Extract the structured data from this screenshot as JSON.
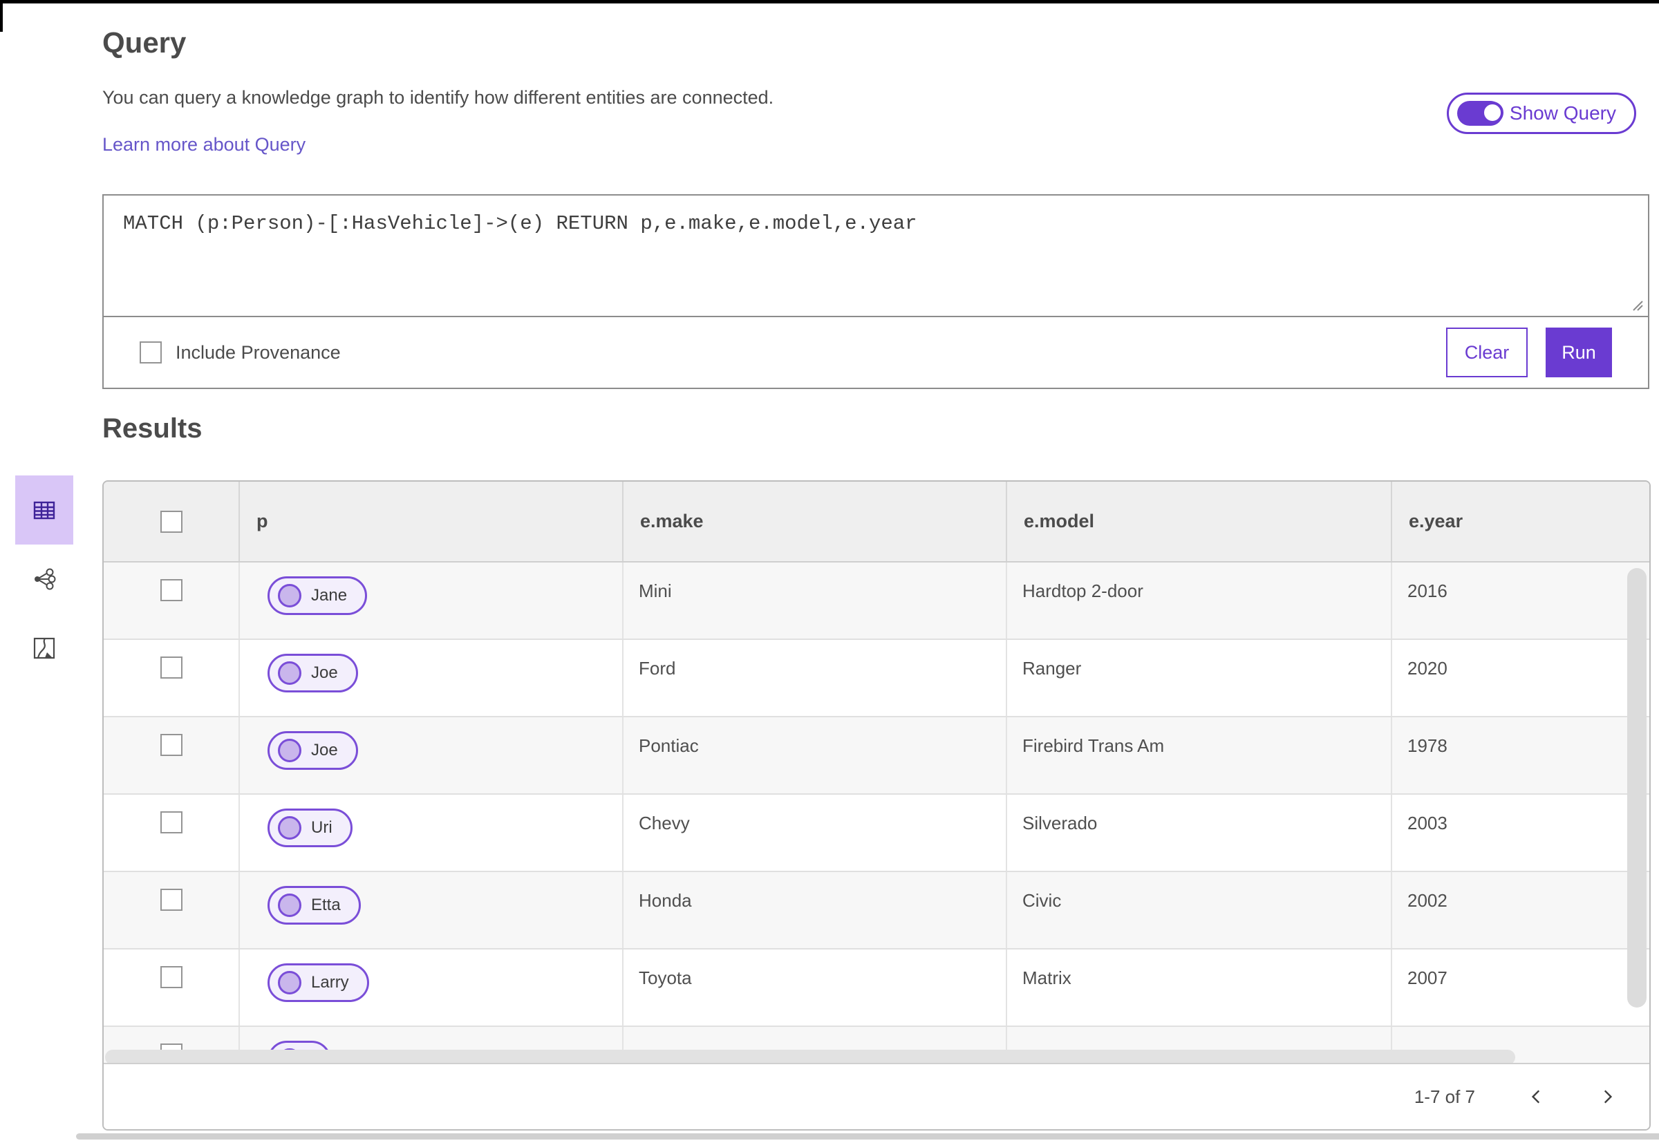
{
  "page": {
    "title": "Query",
    "description": "You can query a knowledge graph to identify how different entities are connected.",
    "learn_more_label": "Learn more about Query",
    "show_query_label": "Show Query",
    "show_query_on": true
  },
  "query_panel": {
    "statement": "MATCH (p:Person)-[:HasVehicle]->(e) RETURN p,e.make,e.model,e.year",
    "include_provenance_label": "Include Provenance",
    "include_provenance_checked": false,
    "clear_label": "Clear",
    "run_label": "Run"
  },
  "results": {
    "title": "Results",
    "view_tabs": [
      {
        "name": "table-view",
        "selected": true
      },
      {
        "name": "link-chart-view",
        "selected": false
      },
      {
        "name": "map-view",
        "selected": false
      }
    ],
    "table": {
      "columns": [
        "p",
        "e.make",
        "e.model",
        "e.year"
      ],
      "rows": [
        {
          "p": "Jane",
          "make": "Mini",
          "model": "Hardtop 2-door",
          "year": "2016"
        },
        {
          "p": "Joe",
          "make": "Ford",
          "model": "Ranger",
          "year": "2020"
        },
        {
          "p": "Joe",
          "make": "Pontiac",
          "model": "Firebird Trans Am",
          "year": "1978"
        },
        {
          "p": "Uri",
          "make": "Chevy",
          "model": "Silverado",
          "year": "2003"
        },
        {
          "p": "Etta",
          "make": "Honda",
          "model": "Civic",
          "year": "2002"
        },
        {
          "p": "Larry",
          "make": "Toyota",
          "model": "Matrix",
          "year": "2007"
        },
        {
          "p": "",
          "make": "",
          "model": "",
          "year": "",
          "partial": true
        }
      ]
    },
    "pagination": {
      "range": "1-7 of 7"
    }
  },
  "colors": {
    "primary_purple": "#6A3BD1",
    "pill_border": "#7A4ED8",
    "pill_fill": "#F3EFFC",
    "pill_dot": "#C9B6EC",
    "selected_tab_bg": "#D9C6F7",
    "link": "#6656c9",
    "header_bg": "#EFEFEF",
    "zebra_row": "#F7F7F7",
    "text": "#4b4b4b"
  }
}
